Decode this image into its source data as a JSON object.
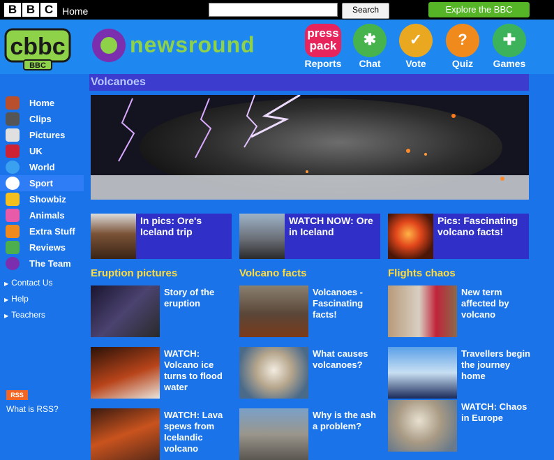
{
  "topbar": {
    "bbc_letters": [
      "B",
      "B",
      "C"
    ],
    "home": "Home",
    "search_value": "",
    "search_button": "Search",
    "explore": "Explore the BBC"
  },
  "header": {
    "cbbc_logo": "cbbc",
    "cbbc_sub": "BBC",
    "newsround": "newsround",
    "nav": [
      {
        "label": "Reports",
        "icon": "press-pack-icon",
        "text": "press pack"
      },
      {
        "label": "Chat",
        "icon": "chat-bubble-icon"
      },
      {
        "label": "Vote",
        "icon": "vote-checkbox-icon"
      },
      {
        "label": "Quiz",
        "icon": "question-mark-icon"
      },
      {
        "label": "Games",
        "icon": "gamepad-icon"
      }
    ]
  },
  "section": {
    "title": "Volcanoes"
  },
  "sidebar": {
    "items": [
      {
        "label": "Home",
        "icon": "house-icon",
        "color": "#b8502e"
      },
      {
        "label": "Clips",
        "icon": "film-clapper-icon",
        "color": "#555555"
      },
      {
        "label": "Pictures",
        "icon": "camera-icon",
        "color": "#e0e0e0"
      },
      {
        "label": "UK",
        "icon": "union-flag-icon",
        "color": "#cc2233"
      },
      {
        "label": "World",
        "icon": "globe-icon",
        "color": "#3aa0f0"
      },
      {
        "label": "Sport",
        "icon": "football-icon",
        "color": "#ffffff"
      },
      {
        "label": "Showbiz",
        "icon": "star-icon",
        "color": "#f5c01e"
      },
      {
        "label": "Animals",
        "icon": "elephant-icon",
        "color": "#e85ba8"
      },
      {
        "label": "Extra Stuff",
        "icon": "puzzle-icon",
        "color": "#f08a1d"
      },
      {
        "label": "Reviews",
        "icon": "notepad-icon",
        "color": "#4cae4c"
      },
      {
        "label": "The Team",
        "icon": "newsround-n-icon",
        "color": "#7b2fae"
      }
    ],
    "links": [
      "Contact Us",
      "Help",
      "Teachers"
    ],
    "rss": "RSS",
    "rss_what": "What is RSS?"
  },
  "promos": [
    {
      "title": "In pics: Ore's Iceland trip"
    },
    {
      "title": "WATCH NOW: Ore in Iceland"
    },
    {
      "title": "Pics: Fascinating volcano facts!"
    }
  ],
  "columns": [
    {
      "title": "Eruption pictures",
      "stories": [
        "Story of the eruption",
        "WATCH: Volcano ice turns to flood water",
        "WATCH: Lava spews from Icelandic volcano"
      ]
    },
    {
      "title": "Volcano facts",
      "stories": [
        "Volcanoes - Fascinating facts!",
        "What causes volcanoes?",
        "Why is the ash a problem?"
      ]
    },
    {
      "title": "Flights chaos",
      "stories": [
        "New term affected by volcano",
        "Travellers begin the journey home",
        "WATCH: Chaos in Europe"
      ]
    }
  ]
}
